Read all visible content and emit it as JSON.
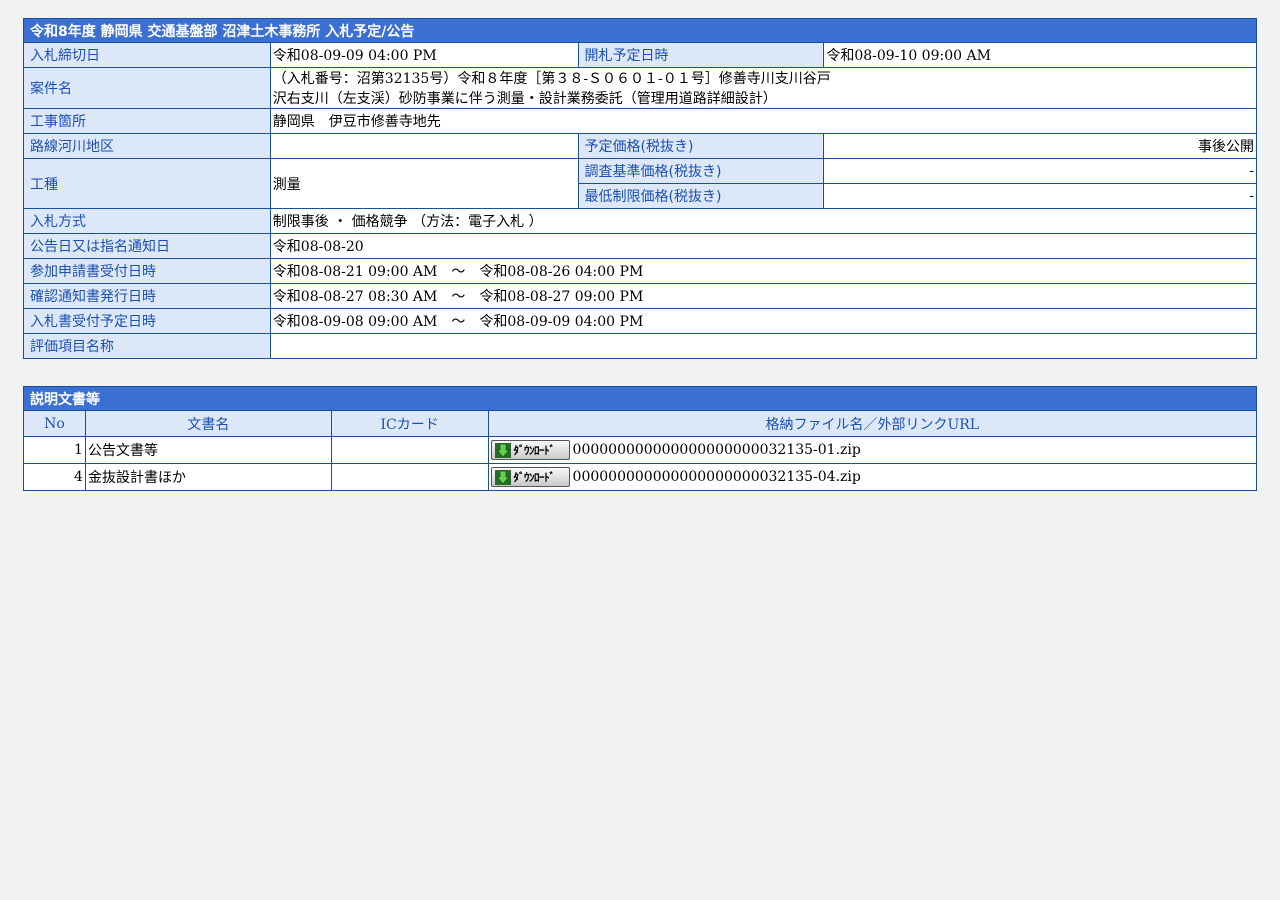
{
  "info": {
    "title": "令和8年度 静岡県 交通基盤部 沼津土木事務所 入札予定/公告",
    "rows": {
      "deadline_label": "入札締切日",
      "deadline_value": "令和08-09-09 04:00 PM",
      "opening_label": "開札予定日時",
      "opening_value": "令和08-09-10 09:00 AM",
      "project_label": "案件名",
      "project_line1": "（入札番号：沼第32135号）令和８年度［第３８-Ｓ０６０１-０１号］修善寺川支川谷戸",
      "project_line2": "沢右支川（左支渓）砂防事業に伴う測量・設計業務委託（管理用道路詳細設計）",
      "location_label": "工事箇所",
      "location_value": "静岡県　伊豆市修善寺地先",
      "route_label": "路線河川地区",
      "route_value": "",
      "planned_price_label": "予定価格(税抜き)",
      "planned_price_value": "事後公開",
      "category_label": "工種",
      "category_value": "測量",
      "survey_price_label": "調査基準価格(税抜き)",
      "survey_price_value": "-",
      "min_price_label": "最低制限価格(税抜き)",
      "min_price_value": "-",
      "method_label": "入札方式",
      "method_value": "制限事後 ・ 価格競争 （方法：電子入札 ）",
      "notice_date_label": "公告日又は指名通知日",
      "notice_date_value": "令和08-08-20",
      "application_label": "参加申請書受付日時",
      "application_value": "令和08-08-21 09:00 AM　～　令和08-08-26 04:00 PM",
      "confirmation_label": "確認通知書発行日時",
      "confirmation_value": "令和08-08-27 08:30 AM　～　令和08-08-27 09:00 PM",
      "bid_receipt_label": "入札書受付予定日時",
      "bid_receipt_value": "令和08-09-08 09:00 AM　～　令和08-09-09 04:00 PM",
      "evaluation_label": "評価項目名称",
      "evaluation_value": ""
    }
  },
  "docs": {
    "title": "説明文書等",
    "headers": {
      "no": "No",
      "name": "文書名",
      "ic_card": "ICカード",
      "file": "格納ファイル名／外部リンクURL"
    },
    "download_label": "ﾀﾞｳﾝﾛｰﾄﾞ",
    "items": [
      {
        "no": "1",
        "name": "公告文書等",
        "ic_card": "",
        "file": "000000000000000000000032135-01.zip"
      },
      {
        "no": "4",
        "name": "金抜設計書ほか",
        "ic_card": "",
        "file": "000000000000000000000032135-04.zip"
      }
    ]
  }
}
